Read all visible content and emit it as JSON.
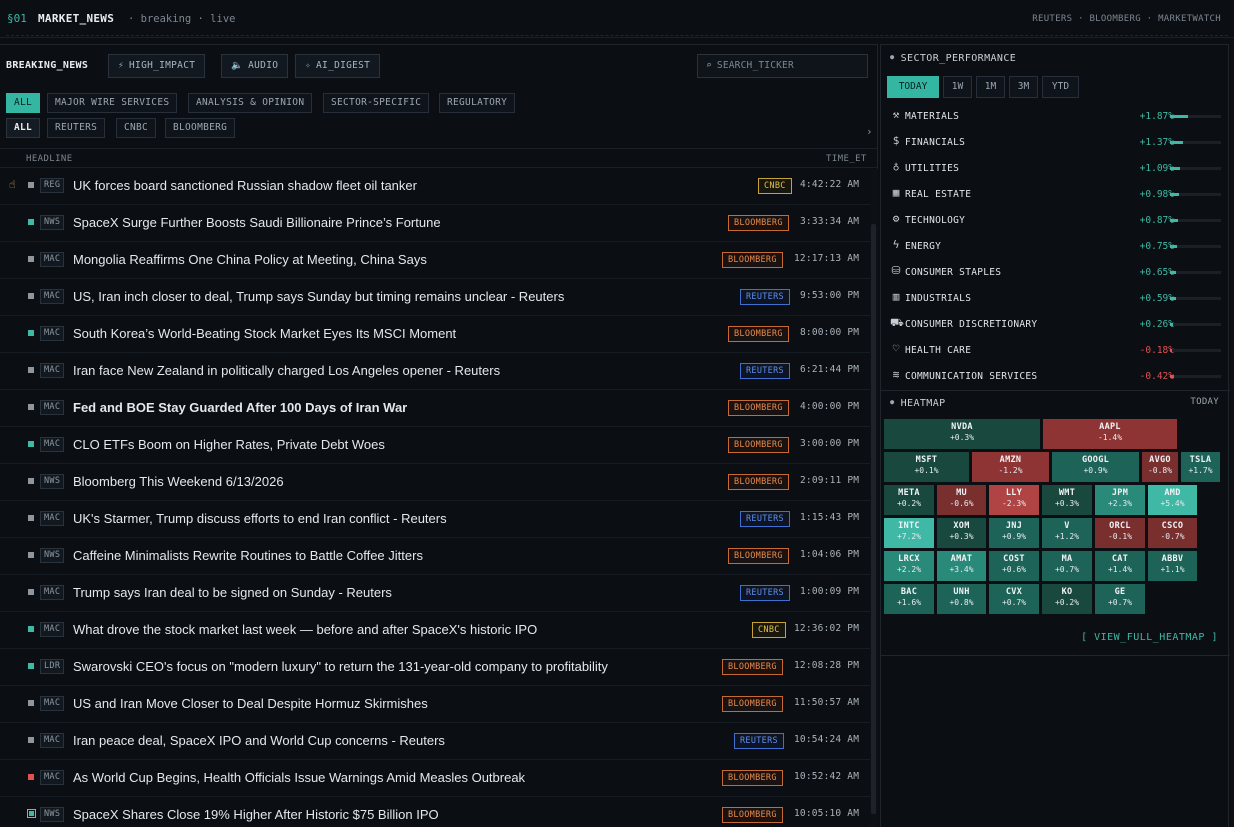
{
  "top": {
    "section": "§01",
    "app_title": "MARKET_NEWS",
    "subtitle": "· breaking · live",
    "sources": "REUTERS · BLOOMBERG · MARKETWATCH"
  },
  "toolbar": {
    "title": "BREAKING_NEWS",
    "high_impact": "HIGH_IMPACT",
    "audio": "AUDIO",
    "ai_digest": "AI_DIGEST",
    "search_placeholder": "SEARCH_TICKER"
  },
  "filters": {
    "categories": [
      "ALL",
      "MAJOR WIRE SERVICES",
      "ANALYSIS & OPINION",
      "SECTOR-SPECIFIC",
      "REGULATORY"
    ],
    "sources": [
      "ALL",
      "REUTERS",
      "CNBC",
      "BLOOMBERG"
    ]
  },
  "columns": {
    "headline": "HEADLINE",
    "time": "TIME_ET"
  },
  "news": [
    {
      "cat": "REG",
      "headline": "UK forces board sanctioned Russian shadow fleet oil tanker",
      "source": "CNBC",
      "time": "4:42:22 AM"
    },
    {
      "cat": "NWS",
      "headline": "SpaceX Surge Further Boosts Saudi Billionaire Prince’s Fortune",
      "source": "BLOOMBERG",
      "time": "3:33:34 AM"
    },
    {
      "cat": "MAC",
      "headline": "Mongolia Reaffirms One China Policy at Meeting, China Says",
      "source": "BLOOMBERG",
      "time": "12:17:13 AM"
    },
    {
      "cat": "MAC",
      "headline": "US, Iran inch closer to deal, Trump says Sunday but timing remains unclear - Reuters",
      "source": "REUTERS",
      "time": "9:53:00 PM"
    },
    {
      "cat": "MAC",
      "headline": "South Korea’s World-Beating Stock Market Eyes Its MSCI Moment",
      "source": "BLOOMBERG",
      "time": "8:00:00 PM"
    },
    {
      "cat": "MAC",
      "headline": "Iran face New Zealand in politically charged Los Angeles opener - Reuters",
      "source": "REUTERS",
      "time": "6:21:44 PM"
    },
    {
      "cat": "MAC",
      "headline": "Fed and BOE Stay Guarded After 100 Days of Iran War",
      "source": "BLOOMBERG",
      "time": "4:00:00 PM"
    },
    {
      "cat": "MAC",
      "headline": "CLO ETFs Boom on Higher Rates, Private Debt Woes",
      "source": "BLOOMBERG",
      "time": "3:00:00 PM"
    },
    {
      "cat": "NWS",
      "headline": "Bloomberg This Weekend 6/13/2026",
      "source": "BLOOMBERG",
      "time": "2:09:11 PM"
    },
    {
      "cat": "MAC",
      "headline": "UK's Starmer, Trump discuss efforts to end Iran conflict - Reuters",
      "source": "REUTERS",
      "time": "1:15:43 PM"
    },
    {
      "cat": "NWS",
      "headline": "Caffeine Minimalists Rewrite Routines to Battle Coffee Jitters",
      "source": "BLOOMBERG",
      "time": "1:04:06 PM"
    },
    {
      "cat": "MAC",
      "headline": "Trump says Iran deal to be signed on Sunday - Reuters",
      "source": "REUTERS",
      "time": "1:00:09 PM"
    },
    {
      "cat": "MAC",
      "headline": "What drove the stock market last week — before and after SpaceX's historic IPO",
      "source": "CNBC",
      "time": "12:36:02 PM"
    },
    {
      "cat": "LDR",
      "headline": "Swarovski CEO's focus on \"modern luxury\" to return the 131-year-old company to profitability",
      "source": "BLOOMBERG",
      "time": "12:08:28 PM"
    },
    {
      "cat": "MAC",
      "headline": "US and Iran Move Closer to Deal Despite Hormuz Skirmishes",
      "source": "BLOOMBERG",
      "time": "11:50:57 AM"
    },
    {
      "cat": "MAC",
      "headline": "Iran peace deal, SpaceX IPO and World Cup concerns - Reuters",
      "source": "REUTERS",
      "time": "10:54:24 AM"
    },
    {
      "cat": "MAC",
      "headline": "As World Cup Begins, Health Officials Issue Warnings Amid Measles Outbreak",
      "source": "BLOOMBERG",
      "time": "10:52:42 AM"
    },
    {
      "cat": "NWS",
      "headline": "SpaceX Shares Close 19% Higher After Historic $75 Billion IPO",
      "source": "BLOOMBERG",
      "time": "10:05:10 AM"
    }
  ],
  "sector_panel": {
    "title": "SECTOR_PERFORMANCE",
    "ranges": [
      "TODAY",
      "1W",
      "1M",
      "3M",
      "YTD"
    ],
    "sectors": [
      {
        "name": "MATERIALS",
        "value": "+1.87%",
        "icon": "pickaxe-icon"
      },
      {
        "name": "FINANCIALS",
        "value": "+1.37%",
        "icon": "dollar-icon"
      },
      {
        "name": "UTILITIES",
        "value": "+1.09%",
        "icon": "bulb-icon"
      },
      {
        "name": "REAL ESTATE",
        "value": "+0.98%",
        "icon": "building-icon"
      },
      {
        "name": "TECHNOLOGY",
        "value": "+0.87%",
        "icon": "chip-icon"
      },
      {
        "name": "ENERGY",
        "value": "+0.75%",
        "icon": "bolt-icon"
      },
      {
        "name": "CONSUMER STAPLES",
        "value": "+0.65%",
        "icon": "basket-icon"
      },
      {
        "name": "INDUSTRIALS",
        "value": "+0.59%",
        "icon": "factory-icon"
      },
      {
        "name": "CONSUMER DISCRETIONARY",
        "value": "+0.26%",
        "icon": "cart-icon"
      },
      {
        "name": "HEALTH CARE",
        "value": "-0.18%",
        "icon": "heart-icon"
      },
      {
        "name": "COMMUNICATION SERVICES",
        "value": "-0.42%",
        "icon": "wifi-icon"
      }
    ]
  },
  "heatmap": {
    "title": "HEATMAP",
    "range": "TODAY",
    "view_full": "[ VIEW_FULL_HEATMAP ]",
    "tiles": [
      {
        "t": "NVDA",
        "p": "+0.3%"
      },
      {
        "t": "AAPL",
        "p": "-1.4%"
      },
      {
        "t": "MSFT",
        "p": "+0.1%"
      },
      {
        "t": "AMZN",
        "p": "-1.2%"
      },
      {
        "t": "GOOGL",
        "p": "+0.9%"
      },
      {
        "t": "AVGO",
        "p": "-0.8%"
      },
      {
        "t": "TSLA",
        "p": "+1.7%"
      },
      {
        "t": "META",
        "p": "+0.2%"
      },
      {
        "t": "MU",
        "p": "-0.6%"
      },
      {
        "t": "LLY",
        "p": "-2.3%"
      },
      {
        "t": "WMT",
        "p": "+0.3%"
      },
      {
        "t": "JPM",
        "p": "+2.3%"
      },
      {
        "t": "AMD",
        "p": "+5.4%"
      },
      {
        "t": "INTC",
        "p": "+7.2%"
      },
      {
        "t": "XOM",
        "p": "+0.3%"
      },
      {
        "t": "JNJ",
        "p": "+0.9%"
      },
      {
        "t": "V",
        "p": "+1.2%"
      },
      {
        "t": "ORCL",
        "p": "-0.1%"
      },
      {
        "t": "CSCO",
        "p": "-0.7%"
      },
      {
        "t": "LRCX",
        "p": "+2.2%"
      },
      {
        "t": "AMAT",
        "p": "+3.4%"
      },
      {
        "t": "COST",
        "p": "+0.6%"
      },
      {
        "t": "MA",
        "p": "+0.7%"
      },
      {
        "t": "CAT",
        "p": "+1.4%"
      },
      {
        "t": "ABBV",
        "p": "+1.1%"
      },
      {
        "t": "BAC",
        "p": "+1.6%"
      },
      {
        "t": "UNH",
        "p": "+0.8%"
      },
      {
        "t": "CVX",
        "p": "+0.7%"
      },
      {
        "t": "KO",
        "p": "+0.2%"
      },
      {
        "t": "GE",
        "p": "+0.7%"
      }
    ]
  },
  "colors": {
    "accent": "#33b6a2",
    "positive": "#3fb8a5",
    "negative": "#e05252",
    "bloomberg": "#e8894a",
    "reuters": "#5b8ff0",
    "cnbc": "#e3c04a"
  }
}
